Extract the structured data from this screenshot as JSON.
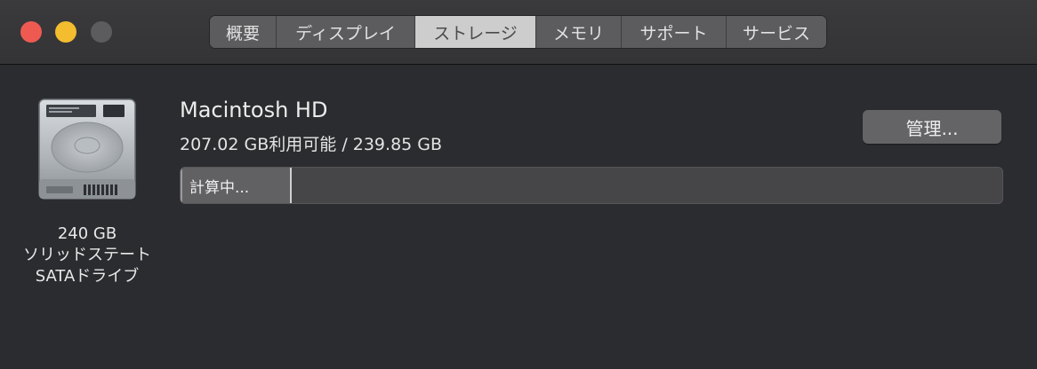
{
  "window": {
    "traffic_lights": [
      "close",
      "minimize",
      "zoom"
    ],
    "colors": {
      "close": "#ee5a52",
      "minimize": "#f3bd2f",
      "zoom": "#5c5c5e"
    }
  },
  "tabs": [
    {
      "label": "概要",
      "active": false
    },
    {
      "label": "ディスプレイ",
      "active": false
    },
    {
      "label": "ストレージ",
      "active": true
    },
    {
      "label": "メモリ",
      "active": false
    },
    {
      "label": "サポート",
      "active": false
    },
    {
      "label": "サービス",
      "active": false
    }
  ],
  "drive": {
    "icon": "hard-drive-icon",
    "size": "240 GB",
    "type_line1": "ソリッドステート",
    "type_line2": "SATAドライブ"
  },
  "volume": {
    "name": "Macintosh HD",
    "capacity": "207.02 GB利用可能 / 239.85 GB",
    "manage_label": "管理...",
    "bar_label": "計算中...",
    "used_fraction": 0.135
  }
}
